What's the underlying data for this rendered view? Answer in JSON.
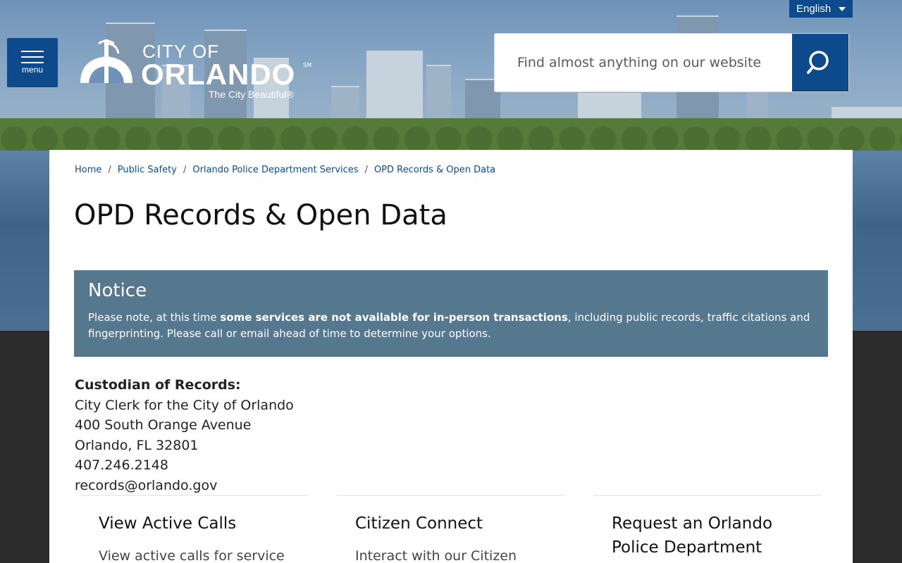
{
  "language": {
    "selected": "English"
  },
  "menu": {
    "label": "menu"
  },
  "logo": {
    "city_of": "CITY OF",
    "name": "ORLANDO",
    "sm": "SM",
    "tagline": "The City Beautiful®"
  },
  "search": {
    "placeholder": "Find almost anything on our website"
  },
  "breadcrumbs": [
    "Home",
    "Public Safety",
    "Orlando Police Department Services",
    "OPD Records & Open Data"
  ],
  "page_title": "OPD Records & Open Data",
  "notice": {
    "heading": "Notice",
    "text_before": "Please note, at this time ",
    "text_bold": "some services are not available for in-person transactions",
    "text_after": ", including public records, traffic citations and fingerprinting. Please call or email ahead of time to determine your options."
  },
  "custodian": {
    "heading": "Custodian of Records:",
    "lines": [
      "City Clerk for the City of Orlando",
      "400 South Orange Avenue",
      "Orlando, FL 32801",
      "407.246.2148",
      "records@orlando.gov"
    ]
  },
  "tiles": [
    {
      "title": "View Active Calls",
      "desc": "View active calls for service"
    },
    {
      "title": "Citizen Connect",
      "desc": "Interact with our Citizen"
    },
    {
      "title": "Request an Orlando Police Department",
      "desc": ""
    }
  ],
  "colors": {
    "brand_blue": "#0c4a8c",
    "notice_bg": "#55788f"
  }
}
